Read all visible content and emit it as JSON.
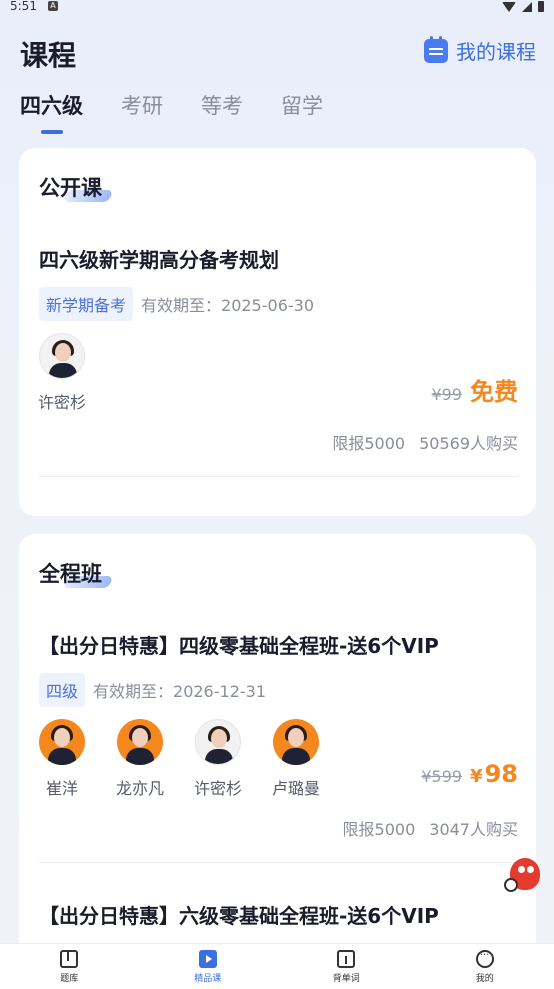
{
  "status_bar": {
    "time": "5:51",
    "app_badge": "A"
  },
  "header": {
    "title": "课程",
    "my_courses_label": "我的课程"
  },
  "tabs": [
    {
      "label": "四六级",
      "active": true
    },
    {
      "label": "考研",
      "active": false
    },
    {
      "label": "等考",
      "active": false
    },
    {
      "label": "留学",
      "active": false
    }
  ],
  "sections": [
    {
      "title": "公开课",
      "courses": [
        {
          "title": "四六级新学期高分备考规划",
          "tag": "新学期备考",
          "valid_until": "有效期至：2025-06-30",
          "teachers": [
            {
              "name": "许密杉"
            }
          ],
          "old_price": "¥99",
          "price_label": "免费",
          "limit": "限报5000",
          "buyers": "50569人购买"
        }
      ]
    },
    {
      "title": "全程班",
      "courses": [
        {
          "title": "【出分日特惠】四级零基础全程班-送6个VIP",
          "tag": "四级",
          "valid_until": "有效期至：2026-12-31",
          "teachers": [
            {
              "name": "崔洋"
            },
            {
              "name": "龙亦凡"
            },
            {
              "name": "许密杉"
            },
            {
              "name": "卢璐曼"
            }
          ],
          "old_price": "¥599",
          "currency": "¥",
          "price": "98",
          "limit": "限报5000",
          "buyers": "3047人购买"
        },
        {
          "title": "【出分日特惠】六级零基础全程班-送6个VIP"
        }
      ]
    }
  ],
  "bottom_nav": [
    {
      "label": "题库",
      "icon": "question-bank-icon",
      "active": false
    },
    {
      "label": "精品课",
      "icon": "video-course-icon",
      "active": true
    },
    {
      "label": "背单词",
      "icon": "vocabulary-book-icon",
      "active": false
    },
    {
      "label": "我的",
      "icon": "profile-chat-icon",
      "active": false
    }
  ],
  "colors": {
    "accent": "#3b6fe0",
    "price": "#f5871f",
    "tag_bg": "#eef2fc"
  }
}
